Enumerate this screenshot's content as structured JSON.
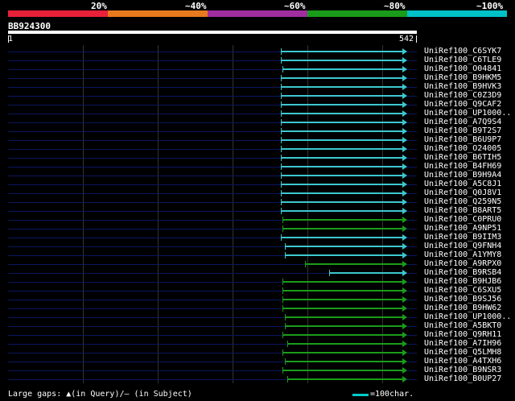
{
  "legend": {
    "labels": [
      "20%",
      "~40%",
      "~60%",
      "~80%",
      "~100%"
    ],
    "colors": [
      "#e8203a",
      "#e87a1e",
      "#a02ea0",
      "#1a9c1a",
      "#00c0c8"
    ]
  },
  "query": {
    "name": "BB924300",
    "start": "1",
    "end": "542"
  },
  "hits": [
    {
      "label": "UniRef100_C6SYK7",
      "start": 375,
      "end": 542,
      "color": "#3cc8d0",
      "arrow": true
    },
    {
      "label": "UniRef100_C6TLE9",
      "start": 375,
      "end": 542,
      "color": "#3cc8d0",
      "arrow": true
    },
    {
      "label": "UniRef100_O04841",
      "start": 378,
      "end": 542,
      "color": "#3cc8d0",
      "arrow": true
    },
    {
      "label": "UniRef100_B9HKM5",
      "start": 375,
      "end": 542,
      "color": "#3cc8d0",
      "arrow": true
    },
    {
      "label": "UniRef100_B9HVK3",
      "start": 375,
      "end": 542,
      "color": "#3cc8d0",
      "arrow": true
    },
    {
      "label": "UniRef100_C0Z3D9",
      "start": 375,
      "end": 542,
      "color": "#3cc8d0",
      "arrow": true
    },
    {
      "label": "UniRef100_Q9CAF2",
      "start": 375,
      "end": 542,
      "color": "#3cc8d0",
      "arrow": true
    },
    {
      "label": "UniRef100_UP1000..",
      "start": 375,
      "end": 542,
      "color": "#3cc8d0",
      "arrow": true
    },
    {
      "label": "UniRef100_A7Q9S4",
      "start": 375,
      "end": 542,
      "color": "#3cc8d0",
      "arrow": true
    },
    {
      "label": "UniRef100_B9T2S7",
      "start": 375,
      "end": 542,
      "color": "#3cc8d0",
      "arrow": true
    },
    {
      "label": "UniRef100_B6U9P7",
      "start": 375,
      "end": 542,
      "color": "#3cc8d0",
      "arrow": true
    },
    {
      "label": "UniRef100_O24005",
      "start": 375,
      "end": 542,
      "color": "#3cc8d0",
      "arrow": true
    },
    {
      "label": "UniRef100_B6TIH5",
      "start": 375,
      "end": 542,
      "color": "#3cc8d0",
      "arrow": true
    },
    {
      "label": "UniRef100_B4FH69",
      "start": 375,
      "end": 542,
      "color": "#3cc8d0",
      "arrow": true
    },
    {
      "label": "UniRef100_B9H9A4",
      "start": 375,
      "end": 542,
      "color": "#3cc8d0",
      "arrow": true
    },
    {
      "label": "UniRef100_A5C8J1",
      "start": 375,
      "end": 542,
      "color": "#3cc8d0",
      "arrow": true
    },
    {
      "label": "UniRef100_Q0J8V1",
      "start": 375,
      "end": 542,
      "color": "#3cc8d0",
      "arrow": true
    },
    {
      "label": "UniRef100_Q259N5",
      "start": 375,
      "end": 542,
      "color": "#3cc8d0",
      "arrow": true
    },
    {
      "label": "UniRef100_B8ART5",
      "start": 375,
      "end": 542,
      "color": "#3cc8d0",
      "arrow": true
    },
    {
      "label": "UniRef100_C0PRU0",
      "start": 378,
      "end": 542,
      "color": "#1a9c1a",
      "arrow": true
    },
    {
      "label": "UniRef100_A9NP51",
      "start": 378,
      "end": 542,
      "color": "#1a9c1a",
      "arrow": true
    },
    {
      "label": "UniRef100_B9IIM3",
      "start": 375,
      "end": 542,
      "color": "#3cc8d0",
      "arrow": true
    },
    {
      "label": "UniRef100_Q9FNH4",
      "start": 381,
      "end": 542,
      "color": "#3cc8d0",
      "arrow": true
    },
    {
      "label": "UniRef100_A1YMY8",
      "start": 381,
      "end": 542,
      "color": "#3cc8d0",
      "arrow": true
    },
    {
      "label": "UniRef100_A9RPX0",
      "start": 408,
      "end": 542,
      "color": "#1a9c1a",
      "arrow": true
    },
    {
      "label": "UniRef100_B9RSB4",
      "start": 441,
      "end": 542,
      "color": "#3cc8d0",
      "arrow": true
    },
    {
      "label": "UniRef100_B9HJB6",
      "start": 378,
      "end": 542,
      "color": "#1a9c1a",
      "arrow": true
    },
    {
      "label": "UniRef100_C6SXU5",
      "start": 378,
      "end": 542,
      "color": "#1a9c1a",
      "arrow": true
    },
    {
      "label": "UniRef100_B9SJ56",
      "start": 378,
      "end": 542,
      "color": "#1a9c1a",
      "arrow": true
    },
    {
      "label": "UniRef100_B9HW62",
      "start": 378,
      "end": 542,
      "color": "#1a9c1a",
      "arrow": true
    },
    {
      "label": "UniRef100_UP1000..",
      "start": 381,
      "end": 542,
      "color": "#1a9c1a",
      "arrow": true
    },
    {
      "label": "UniRef100_A5BKT0",
      "start": 381,
      "end": 542,
      "color": "#1a9c1a",
      "arrow": true
    },
    {
      "label": "UniRef100_Q9RH11",
      "start": 378,
      "end": 542,
      "color": "#1a9c1a",
      "arrow": true
    },
    {
      "label": "UniRef100_A7IH96",
      "start": 384,
      "end": 542,
      "color": "#1a9c1a",
      "arrow": true
    },
    {
      "label": "UniRef100_Q5LMH8",
      "start": 378,
      "end": 542,
      "color": "#1a9c1a",
      "arrow": true
    },
    {
      "label": "UniRef100_A4TXH6",
      "start": 381,
      "end": 542,
      "color": "#1a9c1a",
      "arrow": true
    },
    {
      "label": "UniRef100_B9NSR3",
      "start": 378,
      "end": 542,
      "color": "#1a9c1a",
      "arrow": true
    },
    {
      "label": "UniRef100_B0UP27",
      "start": 384,
      "end": 542,
      "color": "#1a9c1a",
      "arrow": true
    }
  ],
  "footer": {
    "gaps_text": "Large gaps: ▲(in Query)/— (in Subject)",
    "scale_text": "=100char."
  }
}
